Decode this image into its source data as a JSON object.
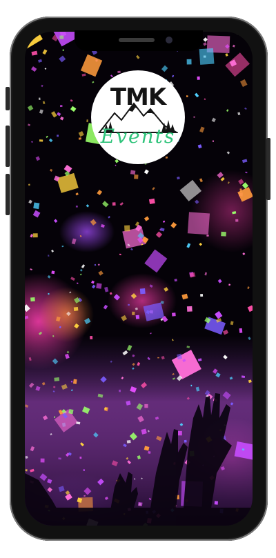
{
  "logo": {
    "title": "TMK",
    "script": "Events"
  },
  "colors": {
    "logo_accent": "#2ec37a",
    "frame": "#111111",
    "screen_bg": "#050208"
  },
  "icons": [
    "camera-icon",
    "speaker-icon"
  ]
}
